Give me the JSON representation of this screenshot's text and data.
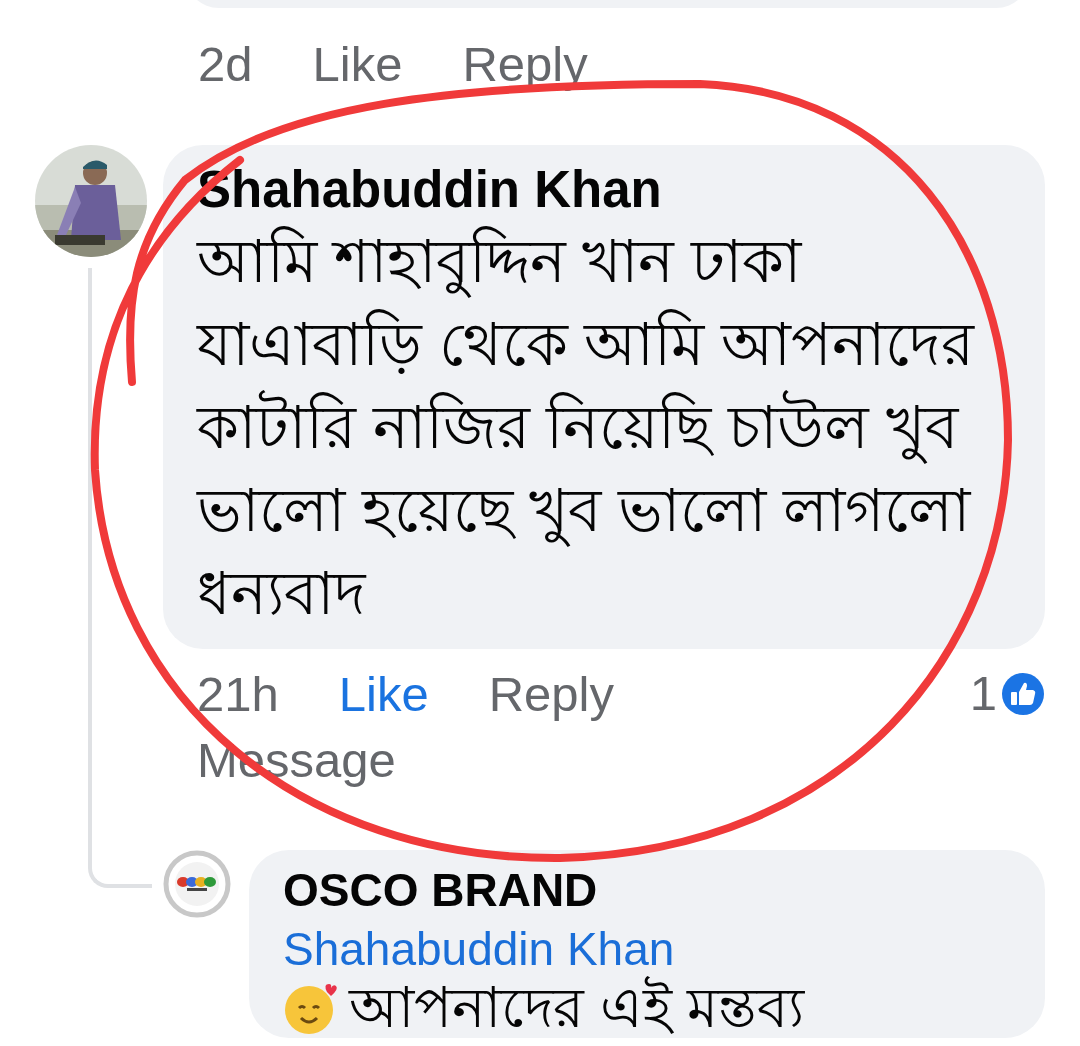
{
  "previous_comment": {
    "time": "2d",
    "like": {
      "label": "Like",
      "liked": false
    },
    "reply": "Reply"
  },
  "comment": {
    "author": "Shahabuddin Khan",
    "text": "আমি শাহাবুদ্দিন খান ঢাকা যাএাবাড়ি থেকে আমি আপনাদের কাটারি নাজির নিয়েছি চাউল খুব ভালো হয়েছে খুব ভালো লাগলো ধন্যবাদ",
    "time": "21h",
    "like": {
      "label": "Like",
      "liked": true
    },
    "reply": "Reply",
    "message": "Message",
    "reaction_count": "1"
  },
  "reply": {
    "author": "OSCO BRAND",
    "mention": "Shahabuddin Khan",
    "text": "আপনাদের এই মন্তব্য"
  }
}
